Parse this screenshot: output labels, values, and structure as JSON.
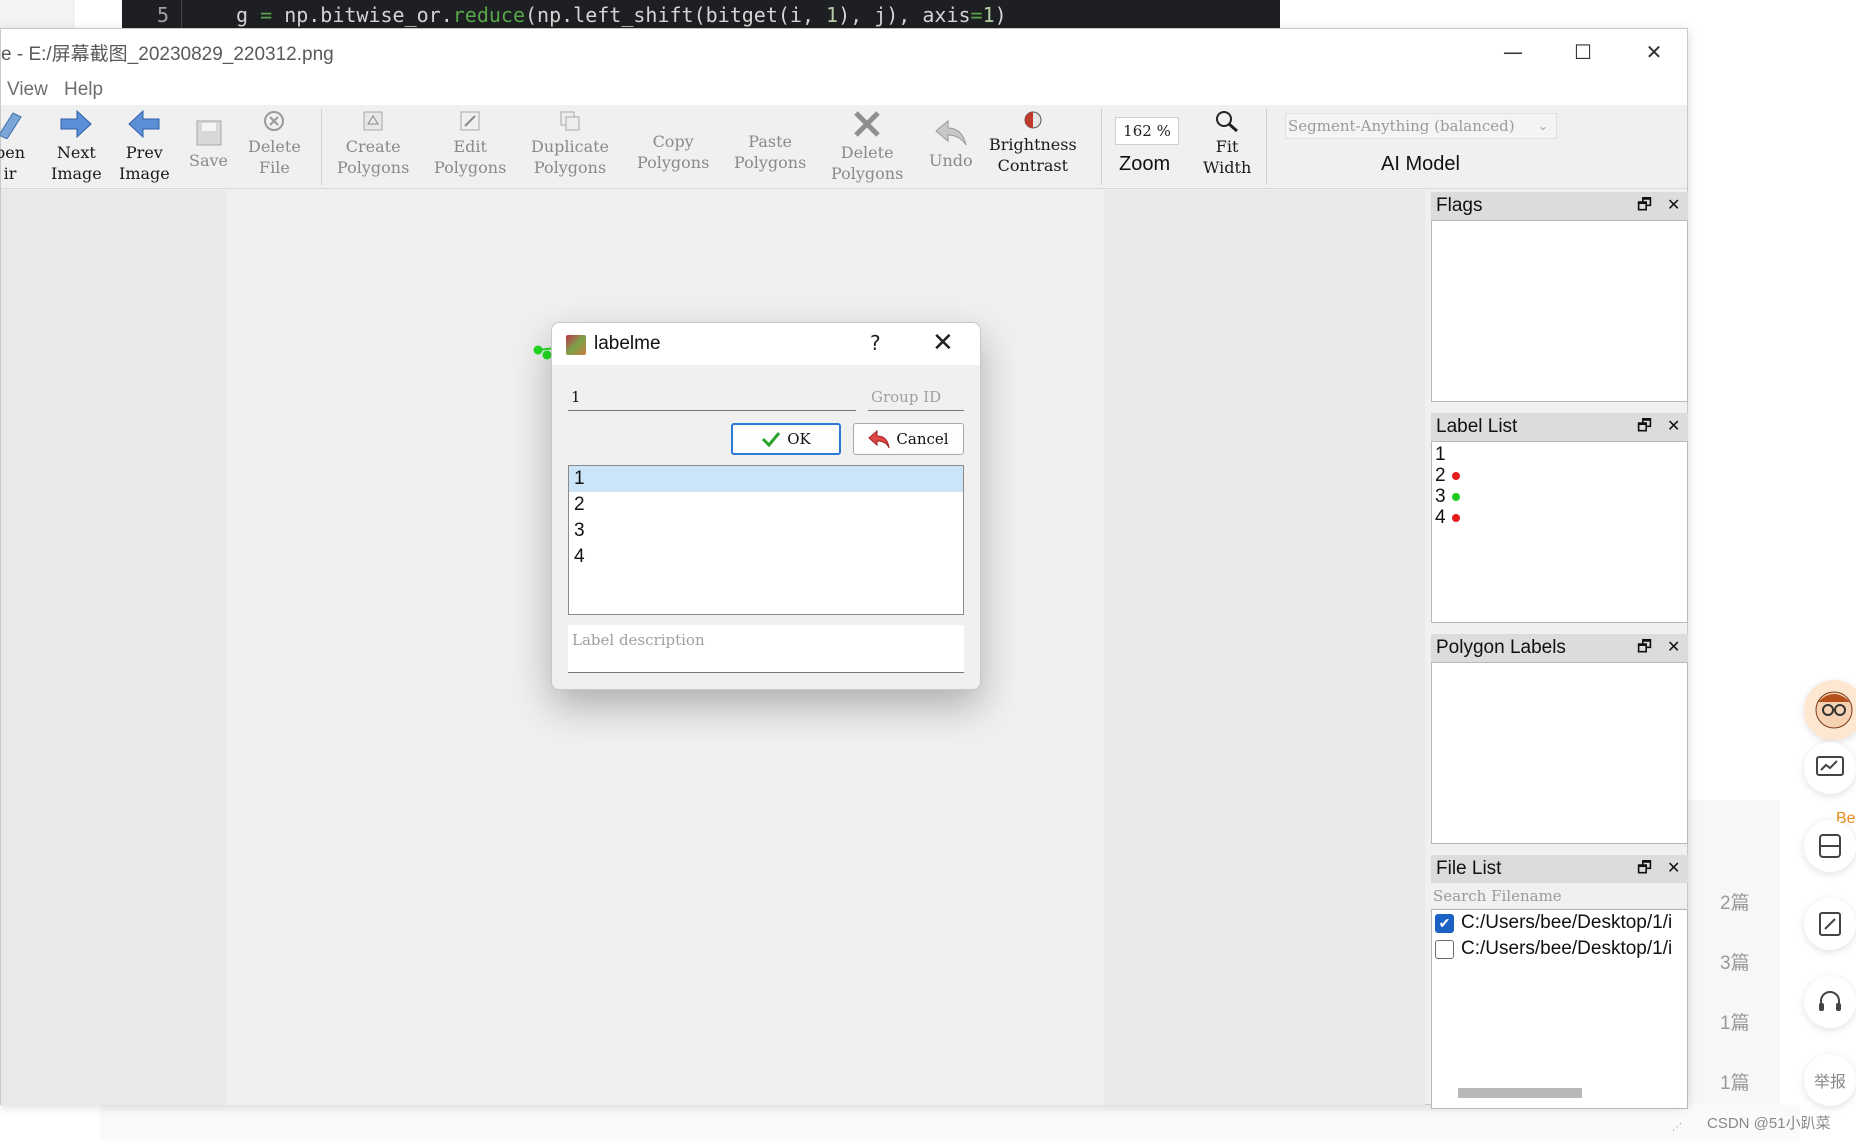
{
  "code_line": {
    "line_number": "5",
    "tokens": [
      {
        "text": "g ",
        "cls": "op"
      },
      {
        "text": "= ",
        "cls": "fn"
      },
      {
        "text": "np.bitwise_or.",
        "cls": "op"
      },
      {
        "text": "reduce",
        "cls": "fn"
      },
      {
        "text": "(np.left_shift(bitget(i, ",
        "cls": "op"
      },
      {
        "text": "1",
        "cls": "num"
      },
      {
        "text": "), j), axis",
        "cls": "op"
      },
      {
        "text": "=",
        "cls": "fn"
      },
      {
        "text": "1",
        "cls": "num"
      },
      {
        "text": ")",
        "cls": "op"
      }
    ]
  },
  "window": {
    "title": "e - E:/屏幕截图_20230829_220312.png",
    "controls": {
      "minimize": "—",
      "maximize": "☐",
      "close": "✕"
    }
  },
  "menu": [
    "View",
    "Help"
  ],
  "toolbar": {
    "open_dir": {
      "line1": "pen",
      "line2": "ir"
    },
    "next_image": {
      "line1": "Next",
      "line2": "Image"
    },
    "prev_image": {
      "line1": "Prev",
      "line2": "Image"
    },
    "save": {
      "line1": "Save"
    },
    "delete_file": {
      "line1": "Delete",
      "line2": "File"
    },
    "create_polygons": {
      "line1": "Create",
      "line2": "Polygons"
    },
    "edit_polygons": {
      "line1": "Edit",
      "line2": "Polygons"
    },
    "duplicate_polygons": {
      "line1": "Duplicate",
      "line2": "Polygons"
    },
    "copy_polygons": {
      "line1": "Copy",
      "line2": "Polygons"
    },
    "paste_polygons": {
      "line1": "Paste",
      "line2": "Polygons"
    },
    "delete_polygons": {
      "line1": "Delete",
      "line2": "Polygons"
    },
    "undo": {
      "line1": "Undo"
    },
    "brightness_contrast": {
      "line1": "Brightness",
      "line2": "Contrast"
    },
    "zoom_value": "162 %",
    "zoom_label": "Zoom",
    "fit_width": {
      "line1": "Fit",
      "line2": "Width"
    },
    "ai_model_value": "Segment-Anything (balanced)",
    "ai_model_label": "AI Model"
  },
  "docks": {
    "flags": {
      "title": "Flags"
    },
    "label_list": {
      "title": "Label List",
      "items": [
        {
          "label": "1",
          "color": ""
        },
        {
          "label": "2",
          "color": "#e31b1b"
        },
        {
          "label": "3",
          "color": "#1ec81e"
        },
        {
          "label": "4",
          "color": "#e31b1b"
        }
      ]
    },
    "polygon_labels": {
      "title": "Polygon Labels"
    },
    "file_list": {
      "title": "File List",
      "search_placeholder": "Search Filename",
      "files": [
        {
          "path": "C:/Users/bee/Desktop/1/i",
          "checked": true
        },
        {
          "path": "C:/Users/bee/Desktop/1/i",
          "checked": false
        }
      ]
    }
  },
  "dialog": {
    "title": "labelme",
    "help": "?",
    "close": "✕",
    "label_value": "1",
    "group_id_placeholder": "Group ID",
    "ok_label": "OK",
    "cancel_label": "Cancel",
    "labels": [
      "1",
      "2",
      "3",
      "4"
    ],
    "selected_index": 0,
    "description_placeholder": "Label description"
  },
  "side_counts": [
    "2篇",
    "3篇",
    "1篇",
    "1篇"
  ],
  "side_widget_text": {
    "be": "Be",
    "report": "举报"
  },
  "watermark": "CSDN @51小趴菜",
  "colors": {
    "polygon": "#22dd22",
    "accent": "#2b7bd6",
    "selection": "#cce4f7"
  }
}
